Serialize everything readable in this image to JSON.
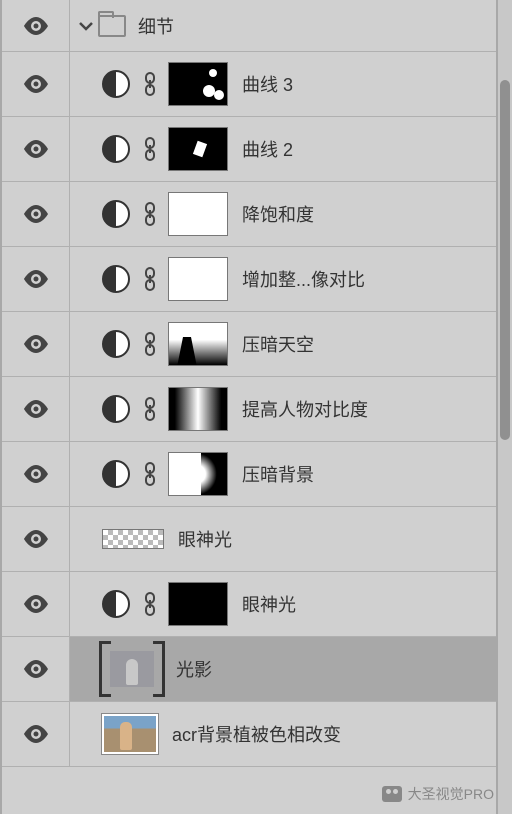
{
  "group": {
    "name": "细节"
  },
  "layers": [
    {
      "name": "曲线 3"
    },
    {
      "name": "曲线 2"
    },
    {
      "name": "降饱和度"
    },
    {
      "name": "增加整...像对比"
    },
    {
      "name": "压暗天空"
    },
    {
      "name": "提高人物对比度"
    },
    {
      "name": "压暗背景"
    },
    {
      "name": "眼神光"
    },
    {
      "name": "眼神光"
    },
    {
      "name": "光影"
    },
    {
      "name": "acr背景植被色相改变"
    }
  ],
  "watermark": "大圣视觉PRO"
}
